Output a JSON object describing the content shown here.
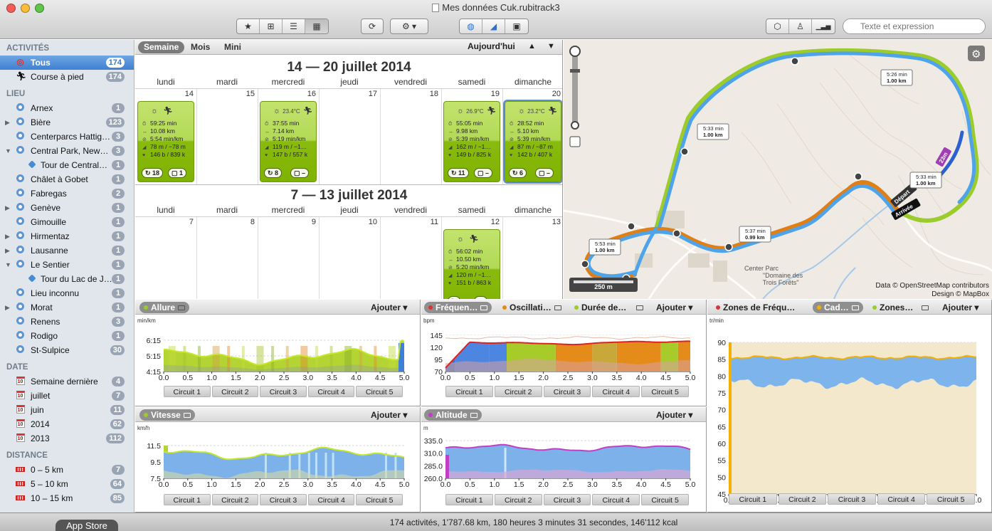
{
  "window": {
    "title": "Mes données Cuk.rubitrack3"
  },
  "toolbar": {
    "view_icons": [
      "star-icon",
      "grid-icon",
      "list-icon",
      "calendar-grid-icon"
    ],
    "refresh_icon": "refresh-icon",
    "gear_icon": "gear-icon",
    "mode_icons": [
      "globe-icon",
      "chart-icon",
      "photo-icon"
    ],
    "right_icons": [
      "box-icon",
      "person-icon",
      "signal-bars-icon"
    ],
    "search_placeholder": "Texte et expression"
  },
  "sidebar": {
    "activites": {
      "header": "ACTIVITÉS",
      "items": [
        {
          "label": "Tous",
          "count": "174",
          "selected": true,
          "icon": "target-icon"
        },
        {
          "label": "Course à pied",
          "count": "174",
          "icon": "runner-icon"
        }
      ]
    },
    "lieu": {
      "header": "LIEU",
      "items": [
        {
          "label": "Arnex",
          "count": "1"
        },
        {
          "label": "Bière",
          "count": "123",
          "expand": true
        },
        {
          "label": "Centerparcs Hattig…",
          "count": "3"
        },
        {
          "label": "Central Park, New…",
          "count": "3",
          "expanded": true
        },
        {
          "label": "Tour de Central…",
          "count": "1",
          "sub": true
        },
        {
          "label": "Châlet à Gobet",
          "count": "1"
        },
        {
          "label": "Fabregas",
          "count": "2"
        },
        {
          "label": "Genève",
          "count": "1",
          "expand": true
        },
        {
          "label": "Gimouille",
          "count": "1"
        },
        {
          "label": "Hirmentaz",
          "count": "1",
          "expand": true
        },
        {
          "label": "Lausanne",
          "count": "1",
          "expand": true
        },
        {
          "label": "Le Sentier",
          "count": "1",
          "expanded": true
        },
        {
          "label": "Tour du Lac de J…",
          "count": "1",
          "sub": true
        },
        {
          "label": "Lieu inconnu",
          "count": "1"
        },
        {
          "label": "Morat",
          "count": "1",
          "expand": true
        },
        {
          "label": "Renens",
          "count": "3"
        },
        {
          "label": "Rodigo",
          "count": "1"
        },
        {
          "label": "St-Sulpice",
          "count": "30"
        }
      ]
    },
    "date": {
      "header": "DATE",
      "items": [
        {
          "label": "Semaine dernière",
          "count": "4"
        },
        {
          "label": "juillet",
          "count": "7"
        },
        {
          "label": "juin",
          "count": "11"
        },
        {
          "label": "2014",
          "count": "62"
        },
        {
          "label": "2013",
          "count": "112"
        }
      ]
    },
    "distance": {
      "header": "DISTANCE",
      "items": [
        {
          "label": "0 – 5 km",
          "count": "7"
        },
        {
          "label": "5 – 10 km",
          "count": "64"
        },
        {
          "label": "10 – 15 km",
          "count": "85"
        }
      ]
    }
  },
  "calendar": {
    "tabs": [
      "Semaine",
      "Mois",
      "Mini"
    ],
    "today": "Aujourd'hui",
    "days": [
      "lundi",
      "mardi",
      "mercredi",
      "jeudi",
      "vendredi",
      "samedi",
      "dimanche"
    ],
    "weeks": [
      {
        "title": "14 — 20 juillet 2014",
        "nums": [
          "14",
          "15",
          "16",
          "17",
          "18",
          "19",
          "20"
        ],
        "cards": [
          {
            "day": 0,
            "temp": "",
            "time": "59:25 min",
            "dist": "10.08 km",
            "pace": "5:54 min/km",
            "elev": "78 m / −78 m",
            "hr": "146 b / 839 k",
            "laps": "18",
            "extra": "1"
          },
          {
            "day": 2,
            "temp": "23.4°C",
            "time": "37:55 min",
            "dist": "7.14 km",
            "pace": "5:19 min/km",
            "elev": "119 m / −1…",
            "hr": "147 b / 557 k",
            "laps": "8",
            "extra": "–"
          },
          {
            "day": 5,
            "temp": "26.9°C",
            "time": "55:05 min",
            "dist": "9.98 km",
            "pace": "5:39 min/km",
            "elev": "162 m / −1…",
            "hr": "149 b / 825 k",
            "laps": "11",
            "extra": "–"
          },
          {
            "day": 6,
            "temp": "23.2°C",
            "time": "28:52 min",
            "dist": "5.10 km",
            "pace": "5:39 min/km",
            "elev": "87 m / −87 m",
            "hr": "142 b / 407 k",
            "laps": "6",
            "extra": "–",
            "selected": true
          }
        ]
      },
      {
        "title": "7 — 13 juillet 2014",
        "nums": [
          "7",
          "8",
          "9",
          "10",
          "11",
          "12",
          "13"
        ],
        "cards": [
          {
            "day": 5,
            "temp": "",
            "time": "56:02 min",
            "dist": "10.50 km",
            "pace": "5:20 min/km",
            "elev": "120 m / −1…",
            "hr": "151 b / 863 k",
            "laps": "",
            "extra": ""
          }
        ]
      }
    ]
  },
  "map": {
    "attribution1": "Data © OpenStreetMap contributors",
    "attribution2": "Design © MapBox",
    "scale": "250 m",
    "place_label1": "Center Parc",
    "place_label2": "\"Domaine des",
    "place_label3": "Trois Forêts\"",
    "start": "Départ",
    "finish": "Arrivée",
    "climb": "23m",
    "splits": [
      {
        "t": "5:26 min",
        "d": "1.00 km"
      },
      {
        "t": "5:33 min",
        "d": "1.00 km"
      },
      {
        "t": "5:33 min",
        "d": "1.00 km"
      },
      {
        "t": "5:37 min",
        "d": "0.99 km"
      },
      {
        "t": "5:53 min",
        "d": "1.00 km"
      }
    ]
  },
  "charts": {
    "ajouter": "Ajouter",
    "circuits": [
      "Circuit 1",
      "Circuit 2",
      "Circuit 3",
      "Circuit 4",
      "Circuit 5"
    ],
    "allure": {
      "tab": "Allure",
      "unit": "min/km",
      "yticks": [
        "6:15",
        "5:15",
        "4:15"
      ],
      "xticks": [
        "0.0",
        "0.5",
        "1.0",
        "1.5",
        "2.0",
        "2.5",
        "3.0",
        "3.5",
        "4.0",
        "4.5",
        "5.0"
      ]
    },
    "frequence": {
      "tabs": [
        "Fréquen…",
        "Oscillati…",
        "Durée de…"
      ],
      "unit": "bpm",
      "yticks": [
        "145",
        "120",
        "95",
        "70"
      ],
      "xticks": [
        "0.0",
        "0.5",
        "1.0",
        "1.5",
        "2.0",
        "2.5",
        "3.0",
        "3.5",
        "4.0",
        "4.5",
        "5.0"
      ]
    },
    "zones": {
      "tabs": [
        "Zones de Fréqu…",
        "Cad…",
        "Zones…"
      ],
      "unit": "tr/min",
      "yticks": [
        "90",
        "85",
        "80",
        "75",
        "70",
        "65",
        "60",
        "55",
        "50",
        "45"
      ],
      "xticks": [
        "0.0",
        "0.5",
        "1.0",
        "1.5",
        "2.0",
        "2.5",
        "3.0",
        "3.5",
        "4.0",
        "4.5",
        "5.0"
      ]
    },
    "vitesse": {
      "tab": "Vitesse",
      "unit": "km/h",
      "yticks": [
        "11.5",
        "9.5",
        "7.5"
      ],
      "xticks": [
        "0.0",
        "0.5",
        "1.0",
        "1.5",
        "2.0",
        "2.5",
        "3.0",
        "3.5",
        "4.0",
        "4.5",
        "5.0"
      ]
    },
    "altitude": {
      "tab": "Altitude",
      "unit": "m",
      "yticks": [
        "335.0",
        "310.0",
        "285.0",
        "260.0"
      ],
      "xticks": [
        "0.0",
        "0.5",
        "1.0",
        "1.5",
        "2.0",
        "2.5",
        "3.0",
        "3.5",
        "4.0",
        "4.5",
        "5.0"
      ]
    }
  },
  "colors": {
    "accent": "#3f80d2",
    "green_card": "#9ccb2c",
    "track_blue": "#4fa3e8"
  },
  "status": {
    "summary": "174 activités, 1'787.68 km, 180 heures 3 minutes 31 secondes, 146'112 kcal",
    "appstore": "App Store"
  }
}
